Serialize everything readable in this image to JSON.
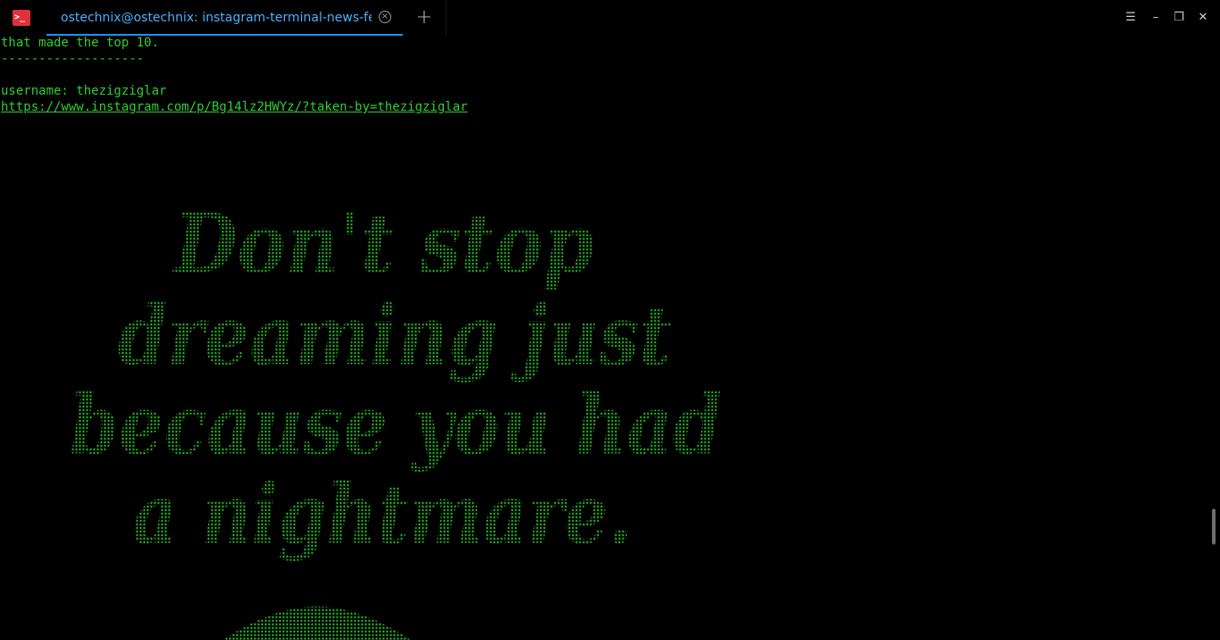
{
  "tab": {
    "title": "ostechnix@ostechnix: instagram-terminal-news-feed",
    "close_glyph": "×",
    "new_tab_glyph": "+"
  },
  "app_icon": {
    "name": "terminal-icon",
    "glyph": ">_"
  },
  "window_controls": {
    "menu_glyph": "☰",
    "minimize_glyph": "–",
    "restore_glyph": "❐",
    "close_glyph": "✕"
  },
  "terminal": {
    "line1": "that made the top 10.",
    "separator": "-------------------",
    "username_line": "username: thezigziglar",
    "post_url": "https://www.instagram.com/p/Bg14lz2HWYz/?taken-by=thezigziglar",
    "ascii_art_text": [
      "Don't stop",
      "dreaming just",
      "because you had",
      "a nightmare."
    ]
  },
  "colors": {
    "background": "#000000",
    "terminal_text": "#2fcf2f",
    "tab_accent": "#1e90ff",
    "tab_text": "#4ab0ff",
    "app_icon": "#e0313b"
  }
}
